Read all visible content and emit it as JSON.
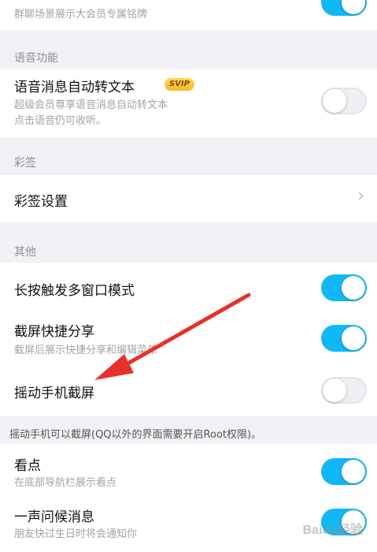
{
  "top_item": {
    "subtitle": "群聊场景展示大会员专属铭牌",
    "toggle_on": true
  },
  "voice_section": {
    "header": "语音功能",
    "item_title": "语音消息自动转文本",
    "badge": "SVIP",
    "subtitle_line1": "超级会员尊享语音消息自动转文本",
    "subtitle_line2": "点击语音仍可收听。",
    "toggle_on": false
  },
  "caiqian_section": {
    "header": "彩签",
    "item_title": "彩签设置",
    "chevron": "›"
  },
  "other_section": {
    "header": "其他",
    "items": [
      {
        "title": "长按触发多窗口模式",
        "subtitle": "",
        "toggle_on": true
      },
      {
        "title": "截屏快捷分享",
        "subtitle": "截屏后展示快捷分享和编辑菜单",
        "toggle_on": true
      },
      {
        "title": "摇动手机截屏",
        "subtitle": "",
        "toggle_on": false
      }
    ]
  },
  "shake_note": "摇动手机可以截屏(QQ以外的界面需要开启Root权限)。",
  "bottom_items": [
    {
      "title": "看点",
      "subtitle": "在底部导航栏展示看点",
      "toggle_on": true
    },
    {
      "title": "一声问候消息",
      "subtitle": "朋友快过生日时将会通知你",
      "toggle_on": true
    }
  ],
  "colors": {
    "toggle_on": "#12b7f5",
    "toggle_off": "#eef0f4",
    "background": "#f1f2f6",
    "annotation_arrow": "#e8302a"
  },
  "watermark": "Baidu经验"
}
